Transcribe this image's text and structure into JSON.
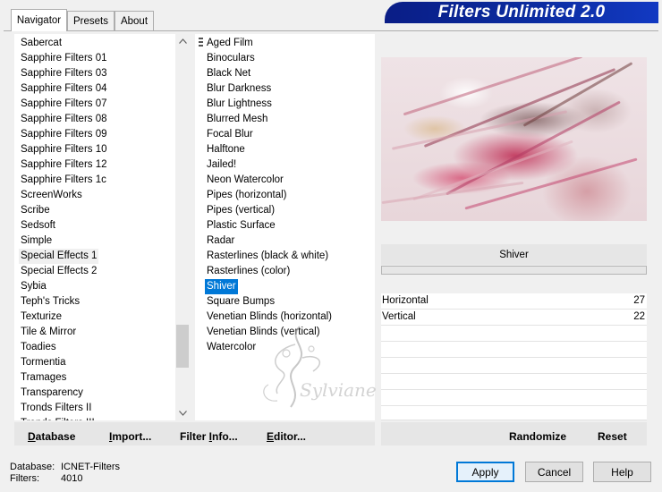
{
  "tabs": [
    {
      "label": "Navigator",
      "active": true
    },
    {
      "label": "Presets",
      "active": false
    },
    {
      "label": "About",
      "active": false
    }
  ],
  "banner_title": "Filters Unlimited 2.0",
  "categories": [
    "Sabercat",
    "Sapphire Filters 01",
    "Sapphire Filters 03",
    "Sapphire Filters 04",
    "Sapphire Filters 07",
    "Sapphire Filters 08",
    "Sapphire Filters 09",
    "Sapphire Filters 10",
    "Sapphire Filters 12",
    "Sapphire Filters 1c",
    "ScreenWorks",
    "Scribe",
    "Sedsoft",
    "Simple",
    "Special Effects 1",
    "Special Effects 2",
    "Sybia",
    "Teph's Tricks",
    "Texturize",
    "Tile & Mirror",
    "Toadies",
    "Tormentia",
    "Tramages",
    "Transparency",
    "Tronds Filters II",
    "Tronds Filters III"
  ],
  "selected_category": "Special Effects 1",
  "filters": [
    "Aged Film",
    "Binoculars",
    "Black Net",
    "Blur Darkness",
    "Blur Lightness",
    "Blurred Mesh",
    "Focal Blur",
    "Halftone",
    "Jailed!",
    "Neon Watercolor",
    "Pipes (horizontal)",
    "Pipes (vertical)",
    "Plastic Surface",
    "Radar",
    "Rasterlines (black & white)",
    "Rasterlines (color)",
    "Shiver",
    "Square Bumps",
    "Venetian Blinds (horizontal)",
    "Venetian Blinds (vertical)",
    "Watercolor"
  ],
  "selected_filter": "Shiver",
  "filter_title": "Shiver",
  "parameters": [
    {
      "label": "Horizontal",
      "value": "27"
    },
    {
      "label": "Vertical",
      "value": "22"
    }
  ],
  "actions": {
    "database": {
      "first": "D",
      "rest": "atabase"
    },
    "import": {
      "first": "I",
      "rest": "mport..."
    },
    "filter_info": {
      "pre": "Filter ",
      "u": "I",
      "post": "nfo..."
    },
    "editor": {
      "first": "E",
      "rest": "ditor..."
    },
    "randomize": "Randomize",
    "reset": "Reset"
  },
  "status": {
    "database_label": "Database:",
    "database_value": "ICNET-Filters",
    "filters_label": "Filters:",
    "filters_value": "4010"
  },
  "buttons": {
    "apply": "Apply",
    "cancel": "Cancel",
    "help": "Help"
  },
  "watermark_text": "Sylviane"
}
